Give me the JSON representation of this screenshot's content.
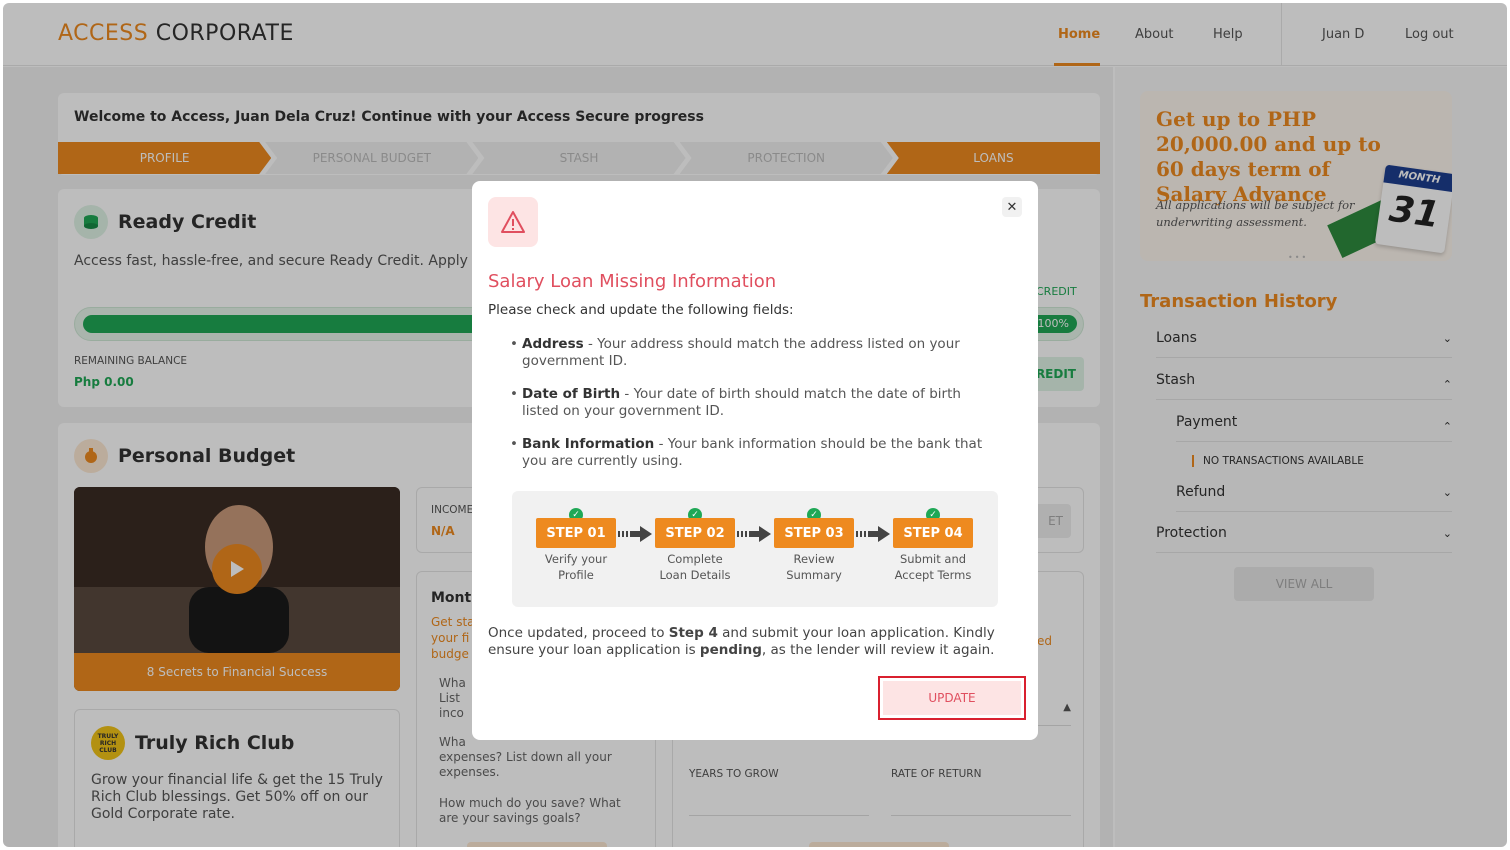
{
  "header": {
    "logo_accent": "ACCESS",
    "logo_rest": "CORPORATE",
    "nav": [
      "Home",
      "About",
      "Help"
    ],
    "user": "Juan D",
    "logout": "Log out"
  },
  "welcome": {
    "text": "Welcome to Access, Juan Dela Cruz! Continue with your Access Secure progress",
    "steps": [
      "PROFILE",
      "PERSONAL BUDGET",
      "STASH",
      "PROTECTION",
      "LOANS"
    ]
  },
  "ready_credit": {
    "title": "Ready Credit",
    "desc": "Access fast, hassle-free, and secure Ready Credit. Apply t",
    "credit_label": "CREDIT",
    "progress_pct": "100%",
    "remaining_label": "REMAINING BALANCE",
    "remaining_value": "Php 0.00",
    "button_tail": "REDIT"
  },
  "personal_budget": {
    "title": "Personal Budget",
    "video_caption": "8 Secrets to Financial Success",
    "income_label": "INCOME",
    "income_value": "N/A",
    "btn_tail": "ET",
    "monthly_title": "Month",
    "monthly_desc": [
      "Get sta",
      "your fi",
      "budge"
    ],
    "orange_tail": "ed",
    "questions": [
      {
        "a": "Wha",
        "b": "List",
        "c": "inco"
      },
      {
        "a": "Wha",
        "b": "expenses? List down all your",
        "c": "expenses."
      },
      {
        "a": "How much do you save? What",
        "b": "are your savings goals?"
      }
    ],
    "years_label": "YEARS TO GROW",
    "rate_label": "RATE OF RETURN"
  },
  "truly_rich": {
    "title": "Truly Rich Club",
    "badge": "TRULY RICH CLUB",
    "desc": "Grow your financial life & get the 15 Truly Rich Club blessings. Get 50% off on our Gold Corporate rate."
  },
  "promo": {
    "title": "Get up to PHP 20,000.00 and up to 60 days term of Salary Advance",
    "subtitle": "All applications will be subject for underwriting assessment.",
    "calendar_month": "MONTH",
    "calendar_day": "31"
  },
  "transactions": {
    "title": "Transaction History",
    "items": [
      "Loans",
      "Stash",
      "Payment",
      "Refund",
      "Protection"
    ],
    "empty": "NO TRANSACTIONS AVAILABLE",
    "view_all": "VIEW ALL"
  },
  "modal": {
    "title": "Salary Loan Missing Information",
    "subtitle": "Please check and update the following fields:",
    "fields": [
      {
        "name": "Address",
        "desc": " - Your address should match the address listed on your government ID."
      },
      {
        "name": "Date of Birth",
        "desc": " - Your date of birth should match the date of birth listed on your government ID."
      },
      {
        "name": "Bank Information",
        "desc": " - Your bank information should be the bank that you are currently using."
      }
    ],
    "steps": [
      {
        "label": "STEP 01",
        "l1": "Verify your",
        "l2": "Profile"
      },
      {
        "label": "STEP 02",
        "l1": "Complete",
        "l2": "Loan Details"
      },
      {
        "label": "STEP 03",
        "l1": "Review",
        "l2": "Summary"
      },
      {
        "label": "STEP 04",
        "l1": "Submit and",
        "l2": "Accept Terms"
      }
    ],
    "footer_1": "Once updated, proceed to ",
    "footer_step": "Step 4",
    "footer_2": " and submit your loan application. Kindly ensure your loan application is ",
    "footer_pending": "pending",
    "footer_3": ", as the lender will review it again.",
    "update_label": "UPDATE"
  },
  "colors": {
    "accent": "#ee8a1f",
    "green": "#1fa856",
    "danger": "#e04f5f"
  }
}
